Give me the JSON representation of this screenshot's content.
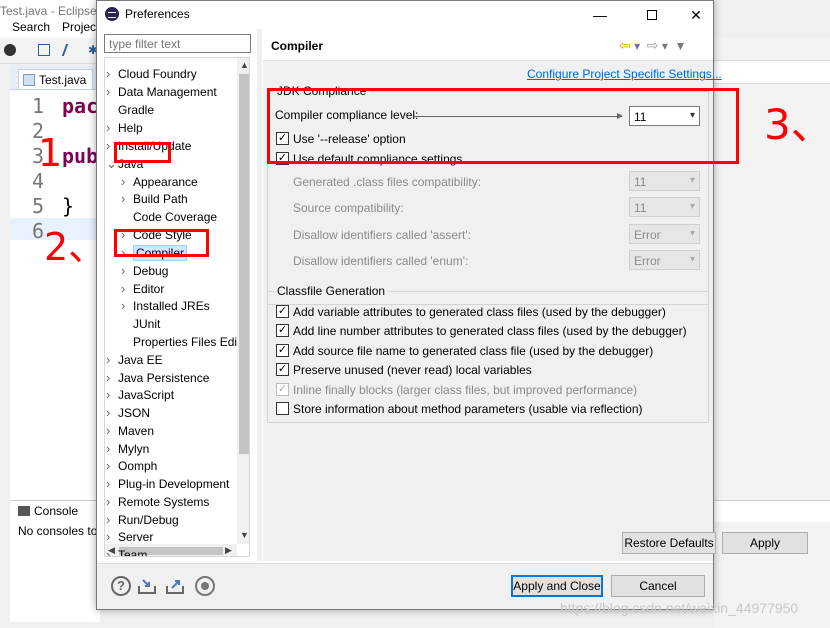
{
  "background": {
    "window_title": "Test.java - Eclipse IDE",
    "menus": [
      "Search",
      "Project"
    ],
    "editor_tab": "Test.java",
    "line_numbers": [
      "1",
      "2",
      "3",
      "4",
      "5",
      "6"
    ],
    "code": {
      "line1": "pac",
      "line3": "pub",
      "line5": "}"
    },
    "console_tab": "Console",
    "console_text": "No consoles to display"
  },
  "annotations": {
    "one": "1",
    "two": "2、",
    "three": "3、"
  },
  "dialog": {
    "title": "Preferences",
    "filter_placeholder": "type filter text",
    "tree": [
      {
        "label": "Cloud Foundry",
        "level": 0,
        "expandable": true
      },
      {
        "label": "Data Management",
        "level": 0,
        "expandable": true
      },
      {
        "label": "Gradle",
        "level": 0,
        "expandable": false
      },
      {
        "label": "Help",
        "level": 0,
        "expandable": true
      },
      {
        "label": "Install/Update",
        "level": 0,
        "expandable": true
      },
      {
        "label": "Java",
        "level": 0,
        "expandable": true,
        "expanded": true
      },
      {
        "label": "Appearance",
        "level": 1,
        "expandable": true
      },
      {
        "label": "Build Path",
        "level": 1,
        "expandable": true
      },
      {
        "label": "Code Coverage",
        "level": 1,
        "expandable": false
      },
      {
        "label": "Code Style",
        "level": 1,
        "expandable": true
      },
      {
        "label": "Compiler",
        "level": 1,
        "expandable": true,
        "selected": true
      },
      {
        "label": "Debug",
        "level": 1,
        "expandable": true
      },
      {
        "label": "Editor",
        "level": 1,
        "expandable": true
      },
      {
        "label": "Installed JREs",
        "level": 1,
        "expandable": true
      },
      {
        "label": "JUnit",
        "level": 1,
        "expandable": false
      },
      {
        "label": "Properties Files Edi",
        "level": 1,
        "expandable": false
      },
      {
        "label": "Java EE",
        "level": 0,
        "expandable": true
      },
      {
        "label": "Java Persistence",
        "level": 0,
        "expandable": true
      },
      {
        "label": "JavaScript",
        "level": 0,
        "expandable": true
      },
      {
        "label": "JSON",
        "level": 0,
        "expandable": true
      },
      {
        "label": "Maven",
        "level": 0,
        "expandable": true
      },
      {
        "label": "Mylyn",
        "level": 0,
        "expandable": true
      },
      {
        "label": "Oomph",
        "level": 0,
        "expandable": true
      },
      {
        "label": "Plug-in Development",
        "level": 0,
        "expandable": true
      },
      {
        "label": "Remote Systems",
        "level": 0,
        "expandable": true
      },
      {
        "label": "Run/Debug",
        "level": 0,
        "expandable": true
      },
      {
        "label": "Server",
        "level": 0,
        "expandable": true
      },
      {
        "label": "Team",
        "level": 0,
        "expandable": true
      }
    ],
    "page": {
      "title": "Compiler",
      "configure_link": "Configure Project Specific Settings...",
      "jdk_group": "JDK Compliance",
      "compliance_label": "Compiler compliance level:",
      "compliance_value": "11",
      "release_option": {
        "label": "Use '--release' option",
        "checked": true
      },
      "default_compliance": {
        "label": "Use default compliance settings",
        "checked": true
      },
      "disabled_fields": [
        {
          "label": "Generated .class files compatibility:",
          "value": "11"
        },
        {
          "label": "Source compatibility:",
          "value": "11"
        },
        {
          "label": "Disallow identifiers called 'assert':",
          "value": "Error"
        },
        {
          "label": "Disallow identifiers called 'enum':",
          "value": "Error"
        }
      ],
      "classfile_group": "Classfile Generation",
      "classfile_options": [
        {
          "label": "Add variable attributes to generated class files (used by the debugger)",
          "checked": true,
          "enabled": true
        },
        {
          "label": "Add line number attributes to generated class files (used by the debugger)",
          "checked": true,
          "enabled": true
        },
        {
          "label": "Add source file name to generated class file (used by the debugger)",
          "checked": true,
          "enabled": true
        },
        {
          "label": "Preserve unused (never read) local variables",
          "checked": true,
          "enabled": true
        },
        {
          "label": "Inline finally blocks (larger class files, but improved performance)",
          "checked": true,
          "enabled": false
        },
        {
          "label": "Store information about method parameters (usable via reflection)",
          "checked": false,
          "enabled": true
        }
      ],
      "restore_defaults": "Restore Defaults",
      "apply": "Apply"
    },
    "apply_and_close": "Apply and Close",
    "cancel": "Cancel"
  },
  "watermark": "https://blog.csdn.net/weixin_44977950",
  "colors": {
    "annotation": "#ff0000",
    "link": "#0066cc",
    "selection": "#cce8ff"
  }
}
